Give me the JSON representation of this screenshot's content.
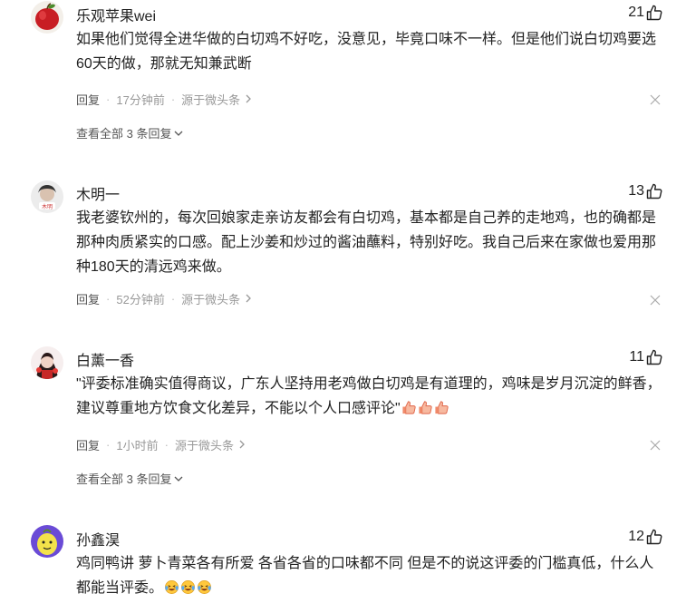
{
  "comments": [
    {
      "username": "乐观苹果wei",
      "likes": "21",
      "text": "如果他们觉得全进华做的白切鸡不好吃，没意见，毕竟口味不一样。但是他们说白切鸡要选60天的做，那就无知兼武断",
      "reply_label": "回复",
      "time": "17分钟前",
      "source": "源于微头条",
      "view_all": "查看全部 3 条回复"
    },
    {
      "username": "木明一",
      "likes": "13",
      "text": "我老婆钦州的，每次回娘家走亲访友都会有白切鸡，基本都是自己养的走地鸡，也的确都是那种肉质紧实的口感。配上沙姜和炒过的酱油蘸料，特别好吃。我自己后来在家做也爱用那种180天的清远鸡来做。",
      "reply_label": "回复",
      "time": "52分钟前",
      "source": "源于微头条"
    },
    {
      "username": "白薰一香",
      "likes": "11",
      "text": "\"评委标准确实值得商议，广东人坚持用老鸡做白切鸡是有道理的，鸡味是岁月沉淀的鲜香，建议尊重地方饮食文化差异，不能以个人口感评论\"",
      "emoji": "thumbs-up-emoji",
      "reply_label": "回复",
      "time": "1小时前",
      "source": "源于微头条",
      "view_all": "查看全部 3 条回复"
    },
    {
      "username": "孙鑫淏",
      "likes": "12",
      "text": "鸡同鸭讲 萝卜青菜各有所爱 各省各省的口味都不同 但是不的说这评委的门槛真低，什么人都能当评委。",
      "emoji": "laughing-crying-emoji"
    }
  ],
  "colors": {
    "text": "#222222",
    "meta": "#999999",
    "reply": "#555555"
  }
}
